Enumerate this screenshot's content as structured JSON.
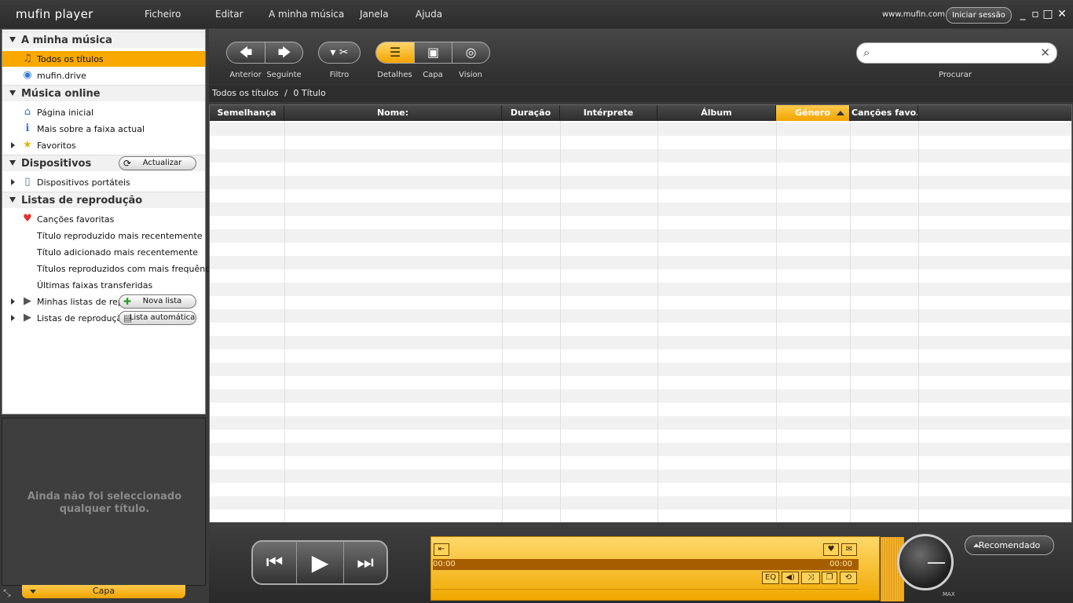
{
  "app": {
    "title": "mufin  player",
    "site": "www.mufin.com",
    "login_label": "Iniciar sessão",
    "window_controls": [
      "minimize-icon",
      "restore-icon",
      "maximize-icon",
      "close-icon"
    ]
  },
  "menu": [
    "Ficheiro",
    "Editar",
    "A minha música",
    "Janela",
    "Ajuda"
  ],
  "sidebar": {
    "sections": [
      {
        "title": "A minha música"
      },
      {
        "title": "Música online"
      },
      {
        "title": "Dispositivos",
        "button": "Actualizar"
      },
      {
        "title": "Listas de reprodução"
      }
    ],
    "my_music": [
      "Todos os títulos",
      "mufin.drive"
    ],
    "online": [
      "Página inicial",
      "Mais sobre a faixa actual",
      "Favoritos"
    ],
    "devices": [
      "Dispositivos portáteis"
    ],
    "playlists": [
      "Canções favoritas",
      "Título reproduzido mais recentemente",
      "Título adicionado mais recentemente",
      "Títulos reproduzidos com mais frequência",
      "Últimas faixas transferidas",
      "Minhas listas de repro",
      "Listas de reprodução a"
    ],
    "new_list_label": "Nova lista",
    "auto_list_label": "Lista automática"
  },
  "info_panel": {
    "line1": "Ainda não foi seleccionado",
    "line2": "qualquer título.",
    "tab_label": "Capa"
  },
  "toolbar": {
    "back_label": "Anterior",
    "next_label": "Seguinte",
    "filter_label": "Filtro",
    "details_label": "Detalhes",
    "cover_label": "Capa",
    "vision_label": "Vision",
    "search_label": "Procurar",
    "search_placeholder": ""
  },
  "breadcrumb": {
    "path": "Todos os títulos",
    "sep": "/",
    "count": "0 Título"
  },
  "table": {
    "columns": [
      "Semelhança",
      "Nome:",
      "Duração",
      "Intérprete",
      "Álbum",
      "Género",
      "Canções favo..."
    ],
    "sorted_column": "Género"
  },
  "player": {
    "time_start": "00:00",
    "time_end": "00:00",
    "eq_label": "EQ",
    "max_label": "MAX",
    "recommended_label": "Recomendado"
  },
  "colors": {
    "accent": "#f9a800",
    "background": "#3a3a3a",
    "panel": "#ffffff"
  }
}
